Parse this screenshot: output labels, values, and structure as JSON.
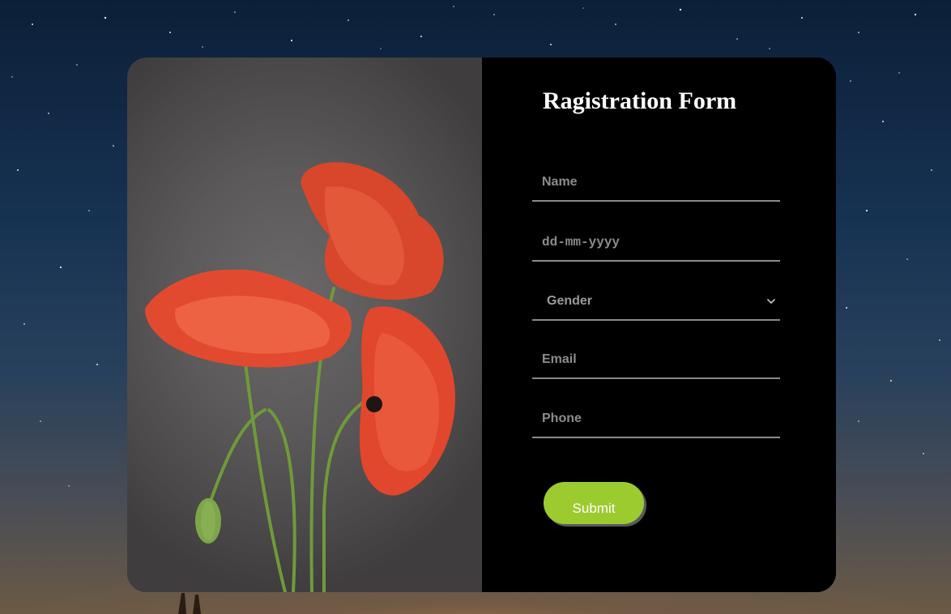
{
  "form": {
    "title": "Ragistration Form",
    "name_placeholder": "Name",
    "dob_placeholder": "dd-mm-yyyy",
    "gender_selected": "Gender",
    "email_placeholder": "Email",
    "phone_placeholder": "Phone",
    "submit_label": "Submit"
  },
  "icons": {
    "gender_dropdown": "chevron-down-icon"
  },
  "colors": {
    "submit_bg": "#9ccb2f",
    "panel_bg": "#000000",
    "underline": "#8a8a8a"
  }
}
